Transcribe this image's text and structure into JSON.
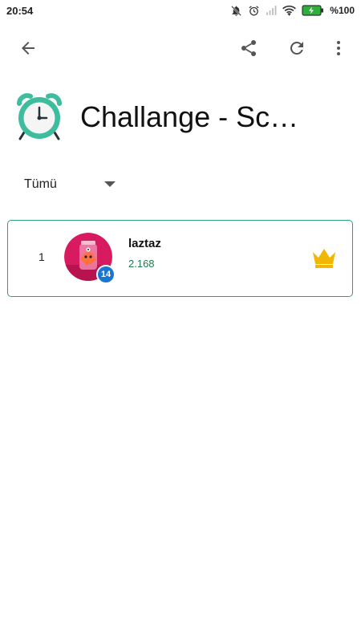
{
  "status_bar": {
    "time": "20:54",
    "battery_text": "%100",
    "icons": [
      "mute-notification-icon",
      "alarm-icon",
      "signal-icon",
      "wifi-icon",
      "battery-charging-icon"
    ]
  },
  "app_bar": {
    "icons": [
      "back-arrow-icon",
      "share-icon",
      "refresh-icon",
      "more-vert-icon"
    ]
  },
  "header": {
    "title": "Challange - Sco…",
    "icon": "alarm-clock-icon",
    "icon_accent": "#3dbd9d"
  },
  "filter": {
    "selected": "Tümü"
  },
  "leaderboard": [
    {
      "rank": "1",
      "username": "laztaz",
      "score": "2.168",
      "level": "14",
      "top_badge": "crown-icon"
    }
  ],
  "colors": {
    "card_border": "#2e9e7a",
    "score": "#1e7a4e",
    "level_badge": "#1976d2",
    "crown": "#f2b705",
    "avatar_bg": "#d81b60"
  }
}
